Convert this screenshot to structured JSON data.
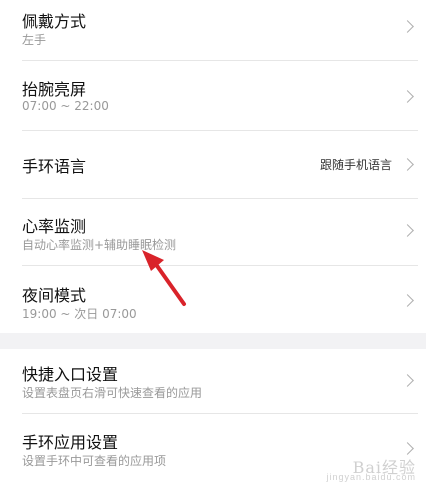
{
  "settings": {
    "wear_mode": {
      "title": "佩戴方式",
      "sub": "左手"
    },
    "raise_wake": {
      "title": "抬腕亮屏",
      "sub": "07:00 ~ 22:00"
    },
    "language": {
      "title": "手环语言",
      "value": "跟随手机语言"
    },
    "heart_rate": {
      "title": "心率监测",
      "sub": "自动心率监测+辅助睡眠检测"
    },
    "night_mode": {
      "title": "夜间模式",
      "sub": "19:00 ~ 次日 07:00"
    },
    "shortcut": {
      "title": "快捷入口设置",
      "sub": "设置表盘页右滑可快速查看的应用"
    },
    "band_apps": {
      "title": "手环应用设置",
      "sub": "设置手环中可查看的应用项"
    }
  },
  "watermark": {
    "brand": "Bai经验",
    "url": "jingyan.baidu.com"
  },
  "colors": {
    "arrow": "#d9232a",
    "gap": "#f2f2f4",
    "subtext": "#999999"
  },
  "icons": {
    "chevron": "chevron-right-icon",
    "arrow": "red-arrow-annotation"
  }
}
